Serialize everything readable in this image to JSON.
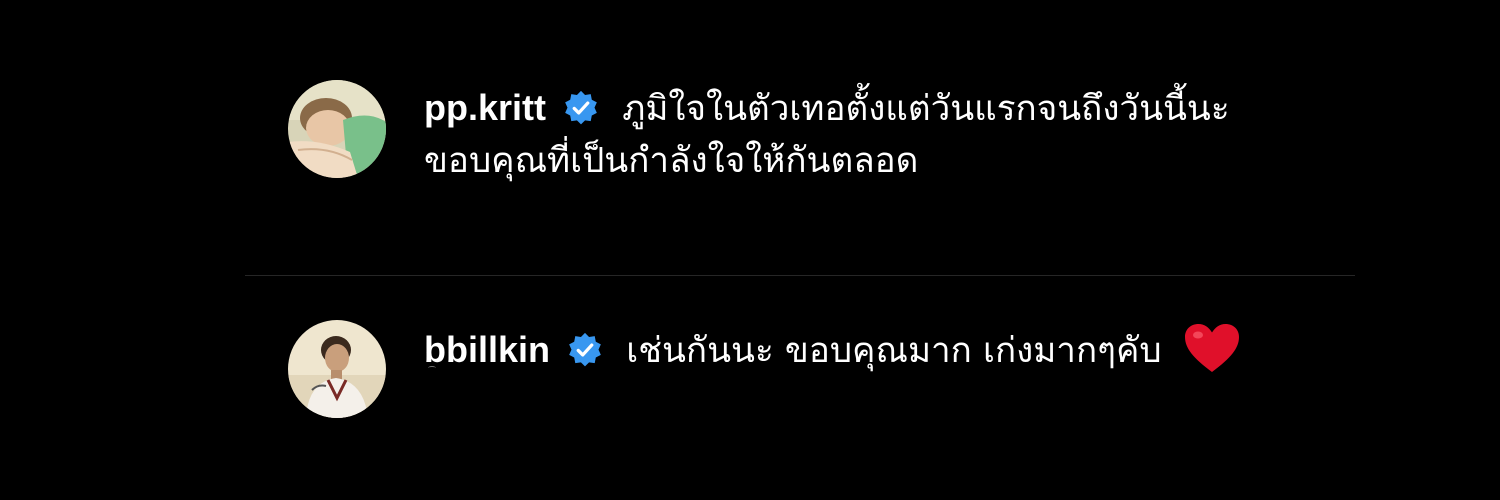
{
  "comments": [
    {
      "username": "pp.kritt",
      "verified": true,
      "text": "ภูมิใจในตัวเทอตั้งแต่วันแรกจนถึงวันนี้นะ ขอบคุณที่เป็นกำลังใจให้กันตลอด",
      "avatar_icon": "avatar-photo"
    },
    {
      "username": "bbillkin",
      "verified": true,
      "text": "เช่นกันนะ ขอบคุณมาก เก่งมากๆคับ",
      "emoji": "red-heart",
      "avatar_icon": "avatar-photo"
    }
  ],
  "colors": {
    "background": "#000000",
    "text": "#ffffff",
    "verified_badge": "#3897f0",
    "heart": "#e0102a",
    "divider": "#262626"
  }
}
